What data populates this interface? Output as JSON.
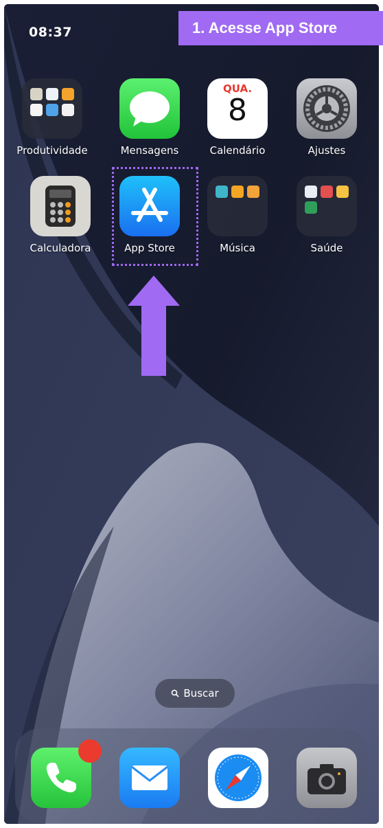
{
  "status_bar": {
    "time": "08:37"
  },
  "instruction": {
    "text": "1. Acesse App Store"
  },
  "apps": [
    {
      "label": "Produtividade",
      "icon": "productivity-folder-icon"
    },
    {
      "label": "Mensagens",
      "icon": "messages-icon"
    },
    {
      "label": "Calendário",
      "icon": "calendar-icon",
      "weekday": "QUA.",
      "day": "8"
    },
    {
      "label": "Ajustes",
      "icon": "settings-icon"
    },
    {
      "label": "Calculadora",
      "icon": "calculator-icon"
    },
    {
      "label": "App Store",
      "icon": "app-store-icon"
    },
    {
      "label": "Música",
      "icon": "music-folder-icon"
    },
    {
      "label": "Saúde",
      "icon": "health-folder-icon"
    }
  ],
  "search": {
    "label": "Buscar",
    "icon": "magnifier-icon"
  },
  "dock": [
    {
      "name": "Phone",
      "icon": "phone-icon"
    },
    {
      "name": "Mail",
      "icon": "mail-icon"
    },
    {
      "name": "Safari",
      "icon": "safari-icon"
    },
    {
      "name": "Camera",
      "icon": "camera-icon"
    }
  ],
  "colors": {
    "accent_purple": "#a06af2",
    "notification_red": "#ea3b2e"
  }
}
